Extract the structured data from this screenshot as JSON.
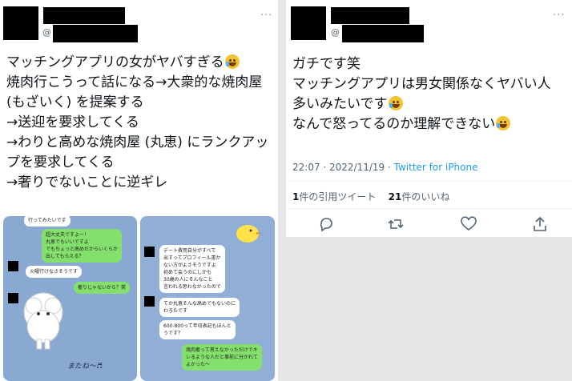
{
  "left_tweet": {
    "handle_prefix": "@",
    "more": "···",
    "lines": [
      "マッチングアプリの女がヤバすぎる",
      "焼肉行こうって話になる→大衆的な焼肉屋",
      "(もざいく) を提案する",
      "→送迎を要求してくる",
      "→わりと高めな焼肉屋 (丸恵) にランクアッ",
      "プを要求してくる",
      "→奢りでないことに逆ギレ"
    ],
    "chat1": {
      "top_msg": "行ってみたいです",
      "green_1": [
        "超大丈夫ですよー！",
        "丸恵でもいいですよ",
        "でもちょっと高めだからいくらか",
        "出してもらえる？"
      ],
      "white_1": "火曜行けなさそうです",
      "green_2": "奢りじゃないから？笑",
      "stamp": "またね〜♬"
    },
    "chat2": {
      "white_1": [
        "デート費用自分がすべて",
        "出すってプロフィール書か",
        "ない方がよさそうですよ",
        "初めて会うのにしかも",
        "30歳の人にそんなこと",
        "言われる思わなかったので"
      ],
      "white_2": [
        "てか丸恵そんな高めでもないのに",
        "わろたです"
      ],
      "white_3": [
        "600-800って年収表記もほんと",
        "うです？"
      ],
      "green_1": [
        "焼肉奢って貰えなかっただけでキ",
        "レるような人だと事前に分かれて",
        "よかった〜"
      ]
    }
  },
  "right_tweet": {
    "handle_prefix": "@",
    "more": "···",
    "lines": [
      "ガチです笑",
      "マッチングアプリは男女関係なくヤバい人",
      "多いみたいです",
      "なんで怒ってるのか理解できない"
    ],
    "time": "22:07 · 2022/11/19 · ",
    "source": "Twitter for iPhone",
    "quote_count": "1",
    "quote_label": "件の引用ツイート",
    "like_count": "21",
    "like_label": "件のいいね"
  },
  "colors": {
    "twitter_blue": "#1d9bf0",
    "line_green": "#84e06c",
    "line_bg": "#8aa9d2"
  },
  "icons": [
    "reply-icon",
    "retweet-icon",
    "like-icon",
    "share-icon"
  ]
}
